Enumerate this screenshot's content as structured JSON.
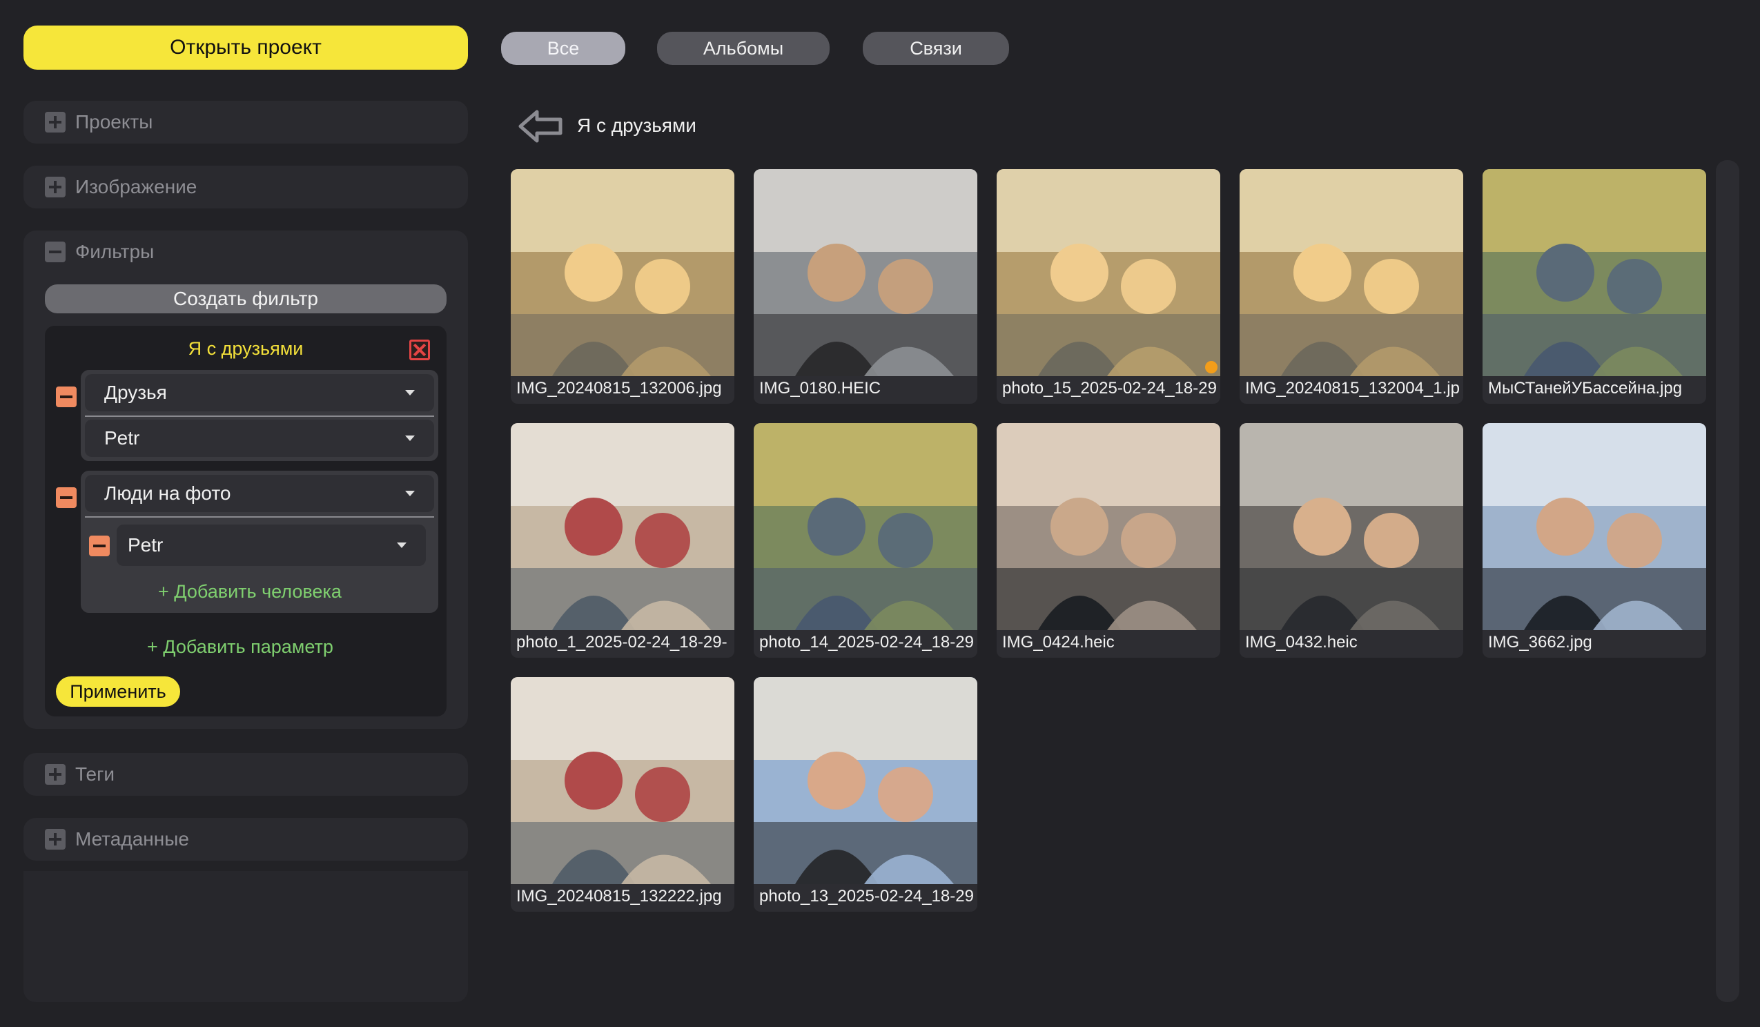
{
  "sidebar": {
    "open_project": "Открыть проект",
    "sections": {
      "projects": "Проекты",
      "image": "Изображение",
      "filters": "Фильтры",
      "tags": "Теги",
      "metadata": "Метаданные"
    },
    "create_filter": "Создать фильтр",
    "filter": {
      "name": "Я с друзьями",
      "param1": {
        "field": "Друзья",
        "value": "Petr"
      },
      "param2": {
        "field": "Люди на фото",
        "person": "Petr"
      },
      "add_person": "+ Добавить человека",
      "add_param": "+ Добавить параметр",
      "apply": "Применить"
    }
  },
  "tabs": {
    "all": "Все",
    "albums": "Альбомы",
    "links": "Связи"
  },
  "main": {
    "album_title": "Я с друзьями",
    "photos": [
      "IMG_20240815_132006.jpg",
      "IMG_0180.HEIC",
      "photo_15_2025-02-24_18-29",
      "IMG_20240815_132004_1.jp",
      "МыСТанейУБассейна.jpg",
      "photo_1_2025-02-24_18-29-",
      "photo_14_2025-02-24_18-29",
      "IMG_0424.heic",
      "IMG_0432.heic",
      "IMG_3662.jpg",
      "IMG_20240815_132222.jpg",
      "photo_13_2025-02-24_18-29"
    ]
  },
  "colors": {
    "accent_yellow": "#f6e63a",
    "remove_orange": "#f08a60",
    "add_green": "#7fcf6f",
    "close_red": "#e44444",
    "marker_orange": "#f29d1a"
  }
}
